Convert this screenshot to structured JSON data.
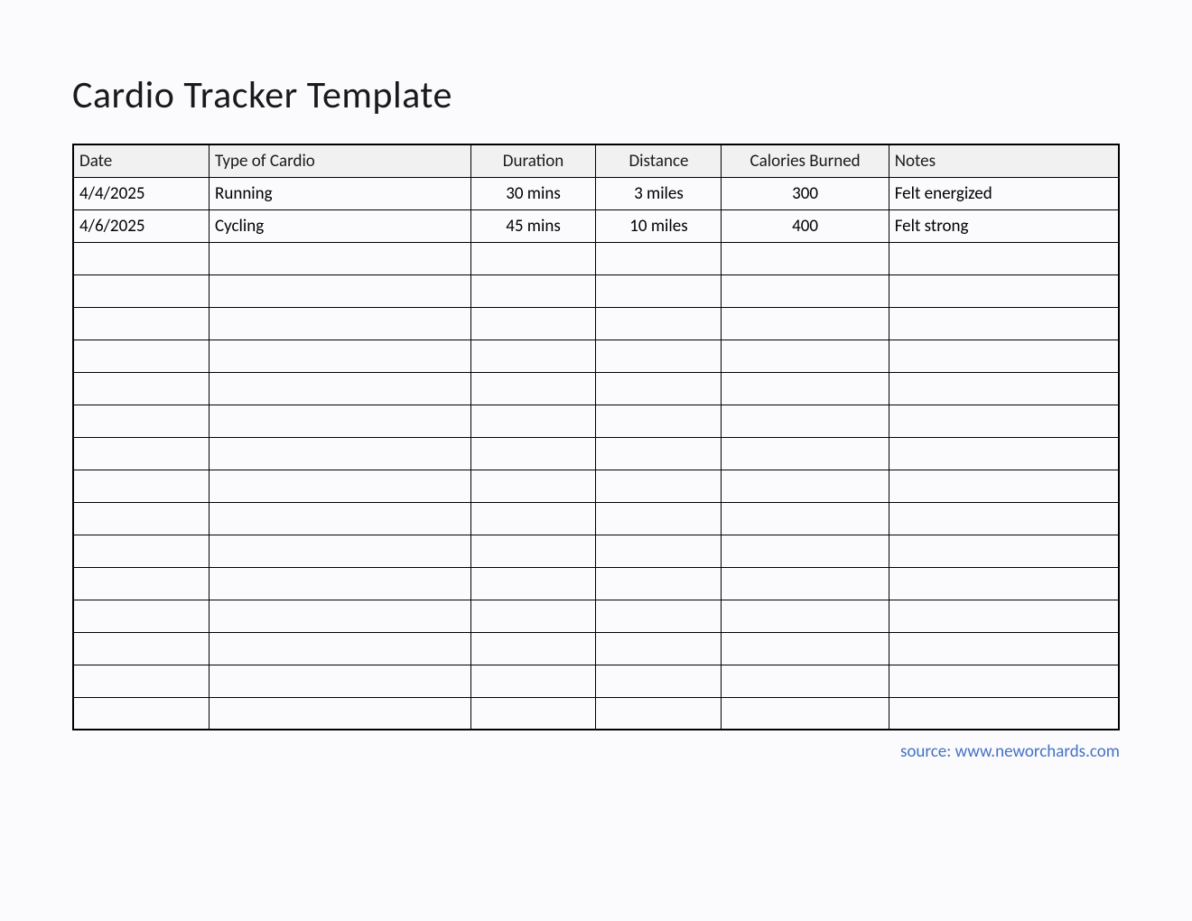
{
  "title": "Cardio Tracker Template",
  "headers": {
    "date": "Date",
    "type": "Type of Cardio",
    "duration": "Duration",
    "distance": "Distance",
    "calories": "Calories Burned",
    "notes": "Notes"
  },
  "rows": [
    {
      "date": "4/4/2025",
      "type": "Running",
      "duration": "30 mins",
      "distance": "3 miles",
      "calories": "300",
      "notes": "Felt energized"
    },
    {
      "date": "4/6/2025",
      "type": "Cycling",
      "duration": "45 mins",
      "distance": "10 miles",
      "calories": "400",
      "notes": "Felt strong"
    },
    {
      "date": "",
      "type": "",
      "duration": "",
      "distance": "",
      "calories": "",
      "notes": ""
    },
    {
      "date": "",
      "type": "",
      "duration": "",
      "distance": "",
      "calories": "",
      "notes": ""
    },
    {
      "date": "",
      "type": "",
      "duration": "",
      "distance": "",
      "calories": "",
      "notes": ""
    },
    {
      "date": "",
      "type": "",
      "duration": "",
      "distance": "",
      "calories": "",
      "notes": ""
    },
    {
      "date": "",
      "type": "",
      "duration": "",
      "distance": "",
      "calories": "",
      "notes": ""
    },
    {
      "date": "",
      "type": "",
      "duration": "",
      "distance": "",
      "calories": "",
      "notes": ""
    },
    {
      "date": "",
      "type": "",
      "duration": "",
      "distance": "",
      "calories": "",
      "notes": ""
    },
    {
      "date": "",
      "type": "",
      "duration": "",
      "distance": "",
      "calories": "",
      "notes": ""
    },
    {
      "date": "",
      "type": "",
      "duration": "",
      "distance": "",
      "calories": "",
      "notes": ""
    },
    {
      "date": "",
      "type": "",
      "duration": "",
      "distance": "",
      "calories": "",
      "notes": ""
    },
    {
      "date": "",
      "type": "",
      "duration": "",
      "distance": "",
      "calories": "",
      "notes": ""
    },
    {
      "date": "",
      "type": "",
      "duration": "",
      "distance": "",
      "calories": "",
      "notes": ""
    },
    {
      "date": "",
      "type": "",
      "duration": "",
      "distance": "",
      "calories": "",
      "notes": ""
    },
    {
      "date": "",
      "type": "",
      "duration": "",
      "distance": "",
      "calories": "",
      "notes": ""
    },
    {
      "date": "",
      "type": "",
      "duration": "",
      "distance": "",
      "calories": "",
      "notes": ""
    }
  ],
  "source": "source: www.neworchards.com"
}
